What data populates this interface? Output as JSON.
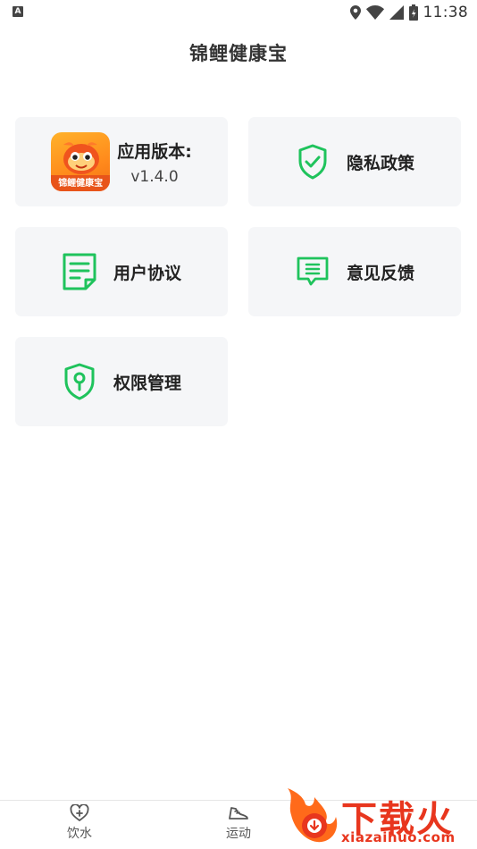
{
  "status_bar": {
    "notification_badge": "A",
    "time": "11:38",
    "icons": [
      "location-icon",
      "wifi-icon",
      "signal-icon",
      "battery-charging-icon"
    ]
  },
  "header": {
    "title": "锦鲤健康宝"
  },
  "cards": {
    "version": {
      "label": "应用版本:",
      "value": "v1.4.0",
      "logo_text": "锦鲤健康宝"
    },
    "privacy": {
      "label": "隐私政策",
      "icon": "shield-check-icon"
    },
    "agreement": {
      "label": "用户协议",
      "icon": "document-icon"
    },
    "feedback": {
      "label": "意见反馈",
      "icon": "message-icon"
    },
    "permission": {
      "label": "权限管理",
      "icon": "shield-key-icon"
    }
  },
  "bottom_nav": {
    "items": [
      {
        "label": "饮水",
        "icon": "heart-plus-icon"
      },
      {
        "label": "运动",
        "icon": "shoe-icon"
      }
    ]
  },
  "watermark": {
    "text": "下载火",
    "url": "xiazaihuo.com"
  },
  "colors": {
    "accent_green": "#1fc35c",
    "card_bg": "#f5f6f8",
    "watermark_red": "#e8361e"
  }
}
